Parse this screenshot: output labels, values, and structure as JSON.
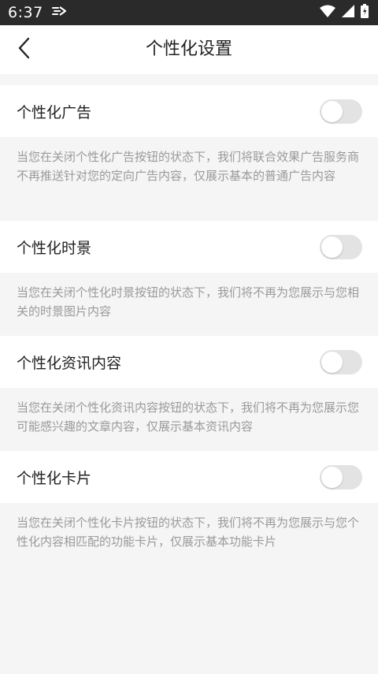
{
  "status_bar": {
    "time": "6:37",
    "icons": [
      "notification-icon",
      "wifi-icon",
      "signal-icon",
      "battery-icon"
    ]
  },
  "header": {
    "title": "个性化设置",
    "back_icon": "chevron-left-icon"
  },
  "settings": [
    {
      "label": "个性化广告",
      "enabled": false,
      "description": "当您在关闭个性化广告按钮的状态下，我们将联合效果广告服务商不再推送针对您的定向广告内容，仅展示基本的普通广告内容"
    },
    {
      "label": "个性化时景",
      "enabled": false,
      "description": "当您在关闭个性化时景按钮的状态下，我们将不再为您展示与您相关的时景图片内容"
    },
    {
      "label": "个性化资讯内容",
      "enabled": false,
      "description": "当您在关闭个性化资讯内容按钮的状态下，我们将不再为您展示您可能感兴趣的文章内容，仅展示基本资讯内容"
    },
    {
      "label": "个性化卡片",
      "enabled": false,
      "description": "当您在关闭个性化卡片按钮的状态下，我们将不再为您展示与您个性化内容相匹配的功能卡片，仅展示基本功能卡片"
    }
  ],
  "colors": {
    "status_bar_bg": "#2a2a2a",
    "page_bg": "#f5f5f5",
    "toggle_off": "#e3e3e3",
    "description_text": "#9a9a9a"
  }
}
